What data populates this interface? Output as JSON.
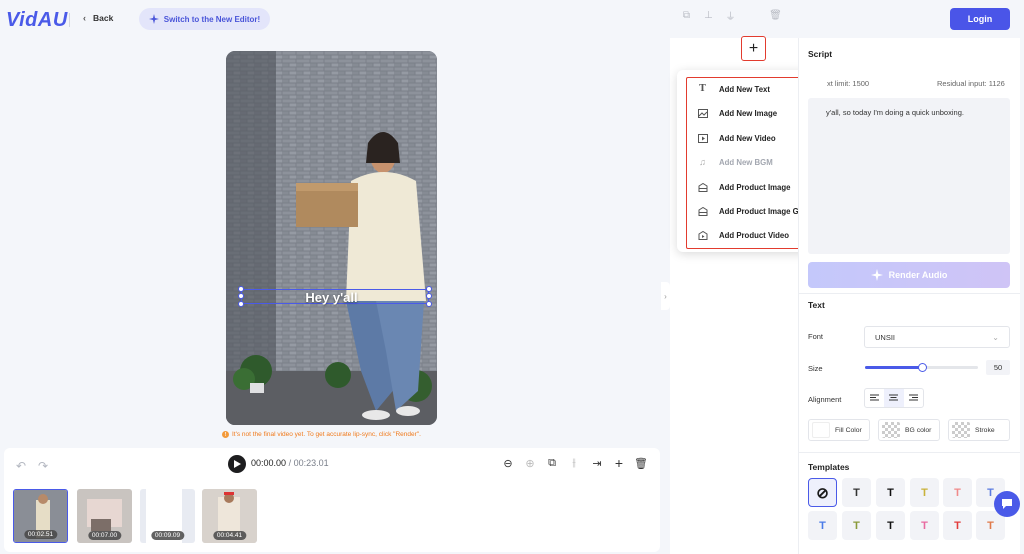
{
  "header": {
    "logo": "VidAU",
    "back_label": "Back",
    "switch_label": "Switch to the New Editor!",
    "login_label": "Login"
  },
  "preview": {
    "caption": "Hey y'all",
    "notice": "It's not the final video yet. To get accurate lip-sync, click \"Render\"."
  },
  "timeline": {
    "current_time": "00:00.00",
    "total_time": "/ 00:23.01",
    "clips": [
      {
        "duration": "00:02.51"
      },
      {
        "duration": "00:07.00"
      },
      {
        "duration": "00:09.09"
      },
      {
        "duration": "00:04.41"
      }
    ]
  },
  "add_menu": {
    "items": [
      {
        "label": "Add New Text",
        "icon": "text-icon"
      },
      {
        "label": "Add New Image",
        "icon": "image-icon"
      },
      {
        "label": "Add New Video",
        "icon": "video-icon"
      },
      {
        "label": "Add New BGM",
        "icon": "music-icon"
      },
      {
        "label": "Add Product Image",
        "icon": "product-image-icon"
      },
      {
        "label": "Add Product Image Group",
        "icon": "product-group-icon"
      },
      {
        "label": "Add Product Video",
        "icon": "product-video-icon"
      }
    ]
  },
  "script": {
    "title": "Script",
    "text_limit": "xt limit: 1500",
    "residual": "Residual input: 1126",
    "content": "y'all, so today I'm doing a quick unboxing.",
    "render_audio": "Render Audio"
  },
  "text_settings": {
    "title": "Text",
    "font_label": "Font",
    "font_value": "UNSII",
    "size_label": "Size",
    "size_value": "50",
    "size_fraction": 0.5,
    "alignment_label": "Alignment",
    "fill_color_label": "Fill Color",
    "bg_color_label": "BG color",
    "stroke_label": "Stroke"
  },
  "templates": {
    "title": "Templates",
    "items": [
      {
        "glyph": "⊘",
        "color": "#1a1a1a"
      },
      {
        "glyph": "T",
        "color": "#333333"
      },
      {
        "glyph": "T",
        "color": "#111111"
      },
      {
        "glyph": "T",
        "color": "#c9b23a"
      },
      {
        "glyph": "T",
        "color": "#f08a8a"
      },
      {
        "glyph": "T",
        "color": "#5b7be0"
      },
      {
        "glyph": "T",
        "color": "#4a7be8"
      },
      {
        "glyph": "T",
        "color": "#8a9a3a"
      },
      {
        "glyph": "T",
        "color": "#111111"
      },
      {
        "glyph": "T",
        "color": "#e86aa0"
      },
      {
        "glyph": "T",
        "color": "#e23b3b"
      },
      {
        "glyph": "T",
        "color": "#e07a4a"
      }
    ]
  },
  "colors": {
    "accent": "#4a5ae8",
    "highlight": "#e23b2e",
    "notice": "#f07a1c"
  }
}
